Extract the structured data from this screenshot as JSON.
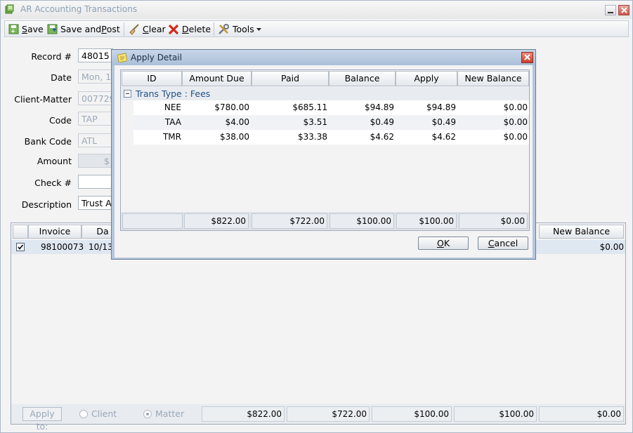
{
  "window": {
    "title": "AR Accounting Transactions"
  },
  "toolbar": {
    "save_key": "S",
    "save_rest": "ave",
    "savepost_pre": "Save and ",
    "savepost_key": "P",
    "savepost_rest": "ost",
    "clear_key": "C",
    "clear_rest": "lear",
    "delete_key": "D",
    "delete_rest": "elete",
    "tools": "Tools"
  },
  "form": {
    "record_label": "Record #",
    "record_value": "48015",
    "date_label": "Date",
    "date_value": "Mon, 10",
    "client_matter_label": "Client-Matter",
    "client_matter_value": "007729",
    "code_label": "Code",
    "code_value": "TAP",
    "bank_code_label": "Bank Code",
    "bank_code_value": "ATL",
    "amount_label": "Amount",
    "amount_value": "$",
    "check_label": "Check #",
    "check_value": "",
    "description_label": "Description",
    "description_value": "Trust Ap"
  },
  "grid": {
    "headers": {
      "invoice": "Invoice",
      "date": "Da",
      "new_balance": "New Balance"
    },
    "row": {
      "checked": true,
      "invoice": "98100073",
      "date": "10/13",
      "new_balance": "$0.00"
    },
    "footer": {
      "apply_to_label": "Apply to:",
      "client_label": "Client",
      "matter_label": "Matter",
      "amount_due": "$822.00",
      "paid": "$722.00",
      "balance": "$100.00",
      "apply": "$100.00",
      "new_balance": "$0.00"
    }
  },
  "dialog": {
    "title": "Apply Detail",
    "columns": [
      "ID",
      "Amount Due",
      "Paid",
      "Balance",
      "Apply",
      "New Balance"
    ],
    "group_label": "Trans Type : Fees",
    "rows": [
      {
        "id": "NEE",
        "amount_due": "$780.00",
        "paid": "$685.11",
        "balance": "$94.89",
        "apply": "$94.89",
        "new_balance": "$0.00"
      },
      {
        "id": "TAA",
        "amount_due": "$4.00",
        "paid": "$3.51",
        "balance": "$0.49",
        "apply": "$0.49",
        "new_balance": "$0.00"
      },
      {
        "id": "TMR",
        "amount_due": "$38.00",
        "paid": "$33.38",
        "balance": "$4.62",
        "apply": "$4.62",
        "new_balance": "$0.00"
      }
    ],
    "totals": {
      "amount_due": "$822.00",
      "paid": "$722.00",
      "balance": "$100.00",
      "apply": "$100.00",
      "new_balance": "$0.00"
    },
    "ok_key": "O",
    "ok_rest": "K",
    "cancel_key": "C",
    "cancel_rest": "ancel"
  }
}
